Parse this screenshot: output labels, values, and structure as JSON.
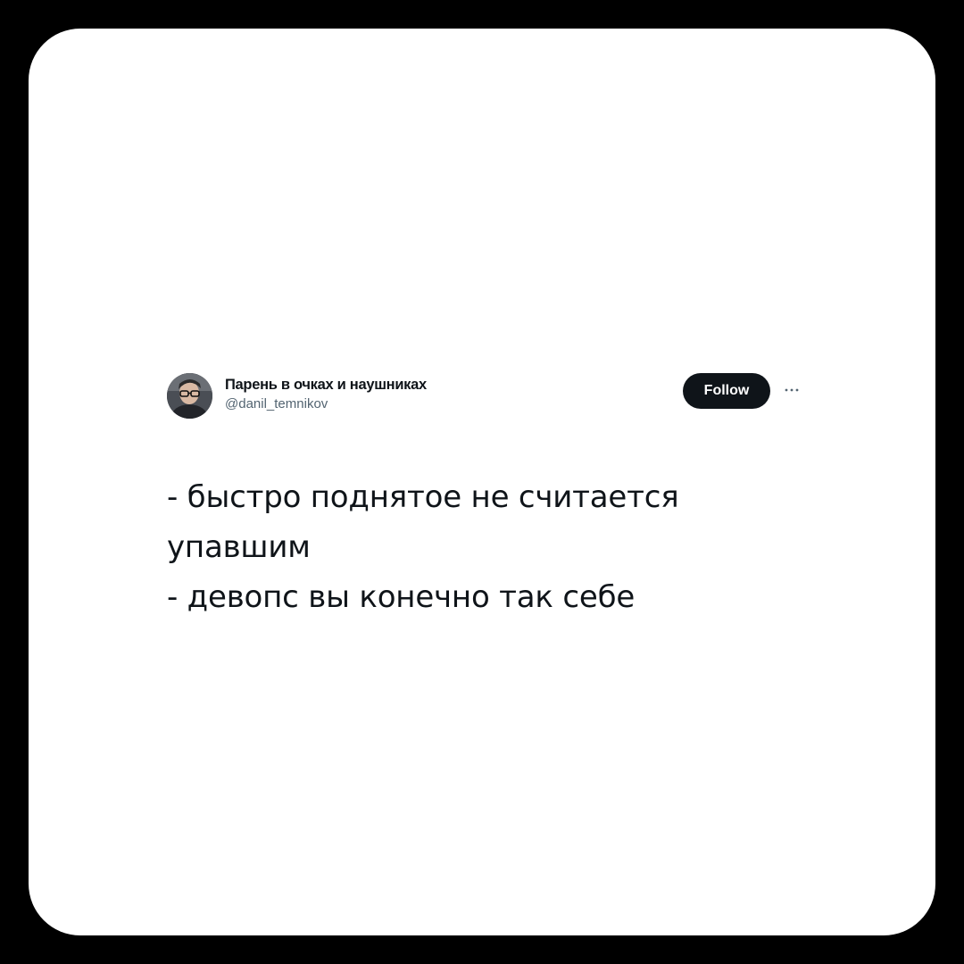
{
  "tweet": {
    "author": {
      "display_name": "Парень в очках и наушниках",
      "handle": "@danil_temnikov",
      "avatar_icon": "user-avatar-photo"
    },
    "follow_label": "Follow",
    "more_icon": "ellipsis-icon",
    "text_lines": [
      "- быстро поднятое не считается",
      "упавшим",
      "- девопс вы конечно так себе"
    ]
  },
  "colors": {
    "background": "#000000",
    "card": "#ffffff",
    "text": "#0f1419",
    "secondary_text": "#536471",
    "follow_button": "#0f1419"
  }
}
